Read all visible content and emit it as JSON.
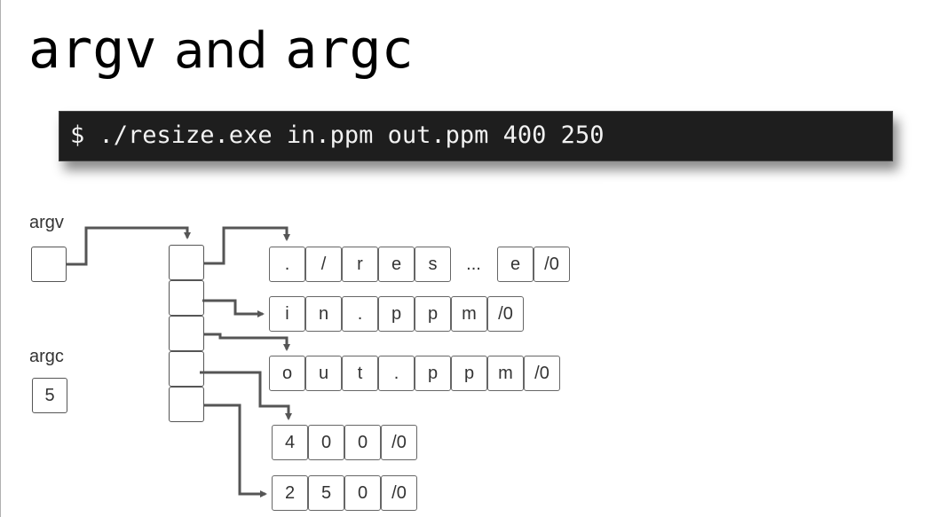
{
  "title": {
    "part1": "argv",
    "part2": "and",
    "part3": "argc"
  },
  "terminal": {
    "command": "$ ./resize.exe in.ppm out.ppm 400 250"
  },
  "labels": {
    "argv": "argv",
    "argc": "argc"
  },
  "argc_value": "5",
  "strings": [
    [
      ".",
      "/",
      "r",
      "e",
      "s",
      "...",
      "e",
      "/0"
    ],
    [
      "i",
      "n",
      ".",
      "p",
      "p",
      "m",
      "/0"
    ],
    [
      "o",
      "u",
      "t",
      ".",
      "p",
      "p",
      "m",
      "/0"
    ],
    [
      "4",
      "0",
      "0",
      "/0"
    ],
    [
      "2",
      "5",
      "0",
      "/0"
    ]
  ]
}
